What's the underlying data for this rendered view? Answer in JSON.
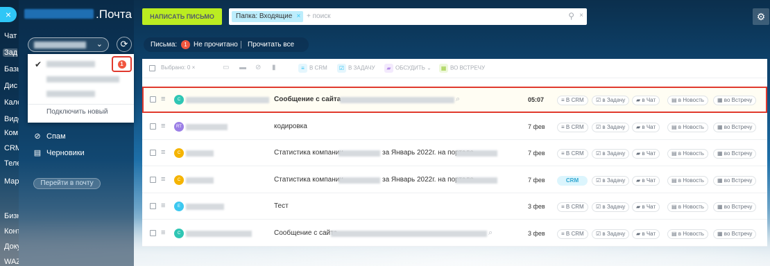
{
  "left_strip": {
    "close_icon": "×",
    "items": [
      "Чат",
      "Зада",
      "Базы",
      "Дис",
      "Кале",
      "Виде",
      "Ком",
      "CRM",
      "Теле",
      "Мар",
      "Бизн",
      "Конт",
      "Доку",
      "WAZ"
    ]
  },
  "panel": {
    "logo_suffix": ".Почта",
    "dropdown": {
      "check_icon": "✔",
      "connect_new": "Подключить новый",
      "unread_badge": "1"
    },
    "nav": [
      {
        "icon": "⊘",
        "label": "Спам"
      },
      {
        "icon": "▤",
        "label": "Черновики"
      }
    ],
    "goto_mail": "Перейти в почту",
    "refresh_icon": "⟳",
    "chevron_icon": "⌄"
  },
  "topbar": {
    "compose_label": "НАПИСАТЬ ПИСЬМО",
    "folder_chip": "Папка: Входящие",
    "chip_close": "×",
    "search_placeholder": "+ поиск",
    "search_icon": "⚲",
    "search_clear": "×",
    "settings_icon": "⚙"
  },
  "counter": {
    "label": "Письма:",
    "unread_count": "1",
    "unread_label": "Не прочитано",
    "read_all": "Прочитать все"
  },
  "toolbar": {
    "selected": "Выбрано: 0",
    "clear": "×",
    "to_crm": "В CRM",
    "to_task": "В ЗАДАЧУ",
    "discuss": "ОБСУДИТЬ",
    "discuss_chevron": "⌄",
    "to_meeting": "ВО ВСТРЕЧУ"
  },
  "actions": {
    "crm": "В CRM",
    "task": "в Задачу",
    "chat": "в Чат",
    "news": "в Новость",
    "meeting": "во Встречу",
    "crm_tag": "CRM"
  },
  "rows": [
    {
      "avatar": "C",
      "avatar_color": "#2fc6b4",
      "subject": "Сообщение с сайта",
      "date": "05:07",
      "bold": true,
      "crm_tag": false
    },
    {
      "avatar": "RT",
      "avatar_color": "#9b7fe6",
      "subject": "кодировка",
      "date": "7 фев",
      "bold": false,
      "crm_tag": false
    },
    {
      "avatar": "C",
      "avatar_color": "#f5b400",
      "subject": "Статистика компании",
      "subject_tail": "за Январь 2022г. на портале",
      "date": "7 фев",
      "bold": false,
      "crm_tag": false
    },
    {
      "avatar": "C",
      "avatar_color": "#f5b400",
      "subject": "Статистика компании",
      "subject_tail": "за Январь 2022г. на портале",
      "date": "7 фев",
      "bold": false,
      "crm_tag": true
    },
    {
      "avatar": "E",
      "avatar_color": "#3cc8f0",
      "subject": "Тест",
      "date": "3 фев",
      "bold": false,
      "crm_tag": false
    },
    {
      "avatar": "C",
      "avatar_color": "#2fc6b4",
      "subject": "Сообщение с сайта",
      "date": "3 фев",
      "bold": false,
      "crm_tag": false
    }
  ],
  "colors": {
    "compose": "#bbed21",
    "highlight_border": "#e0392d",
    "badge": "#f0563f",
    "crm_tag_bg": "#dcf5fd"
  }
}
